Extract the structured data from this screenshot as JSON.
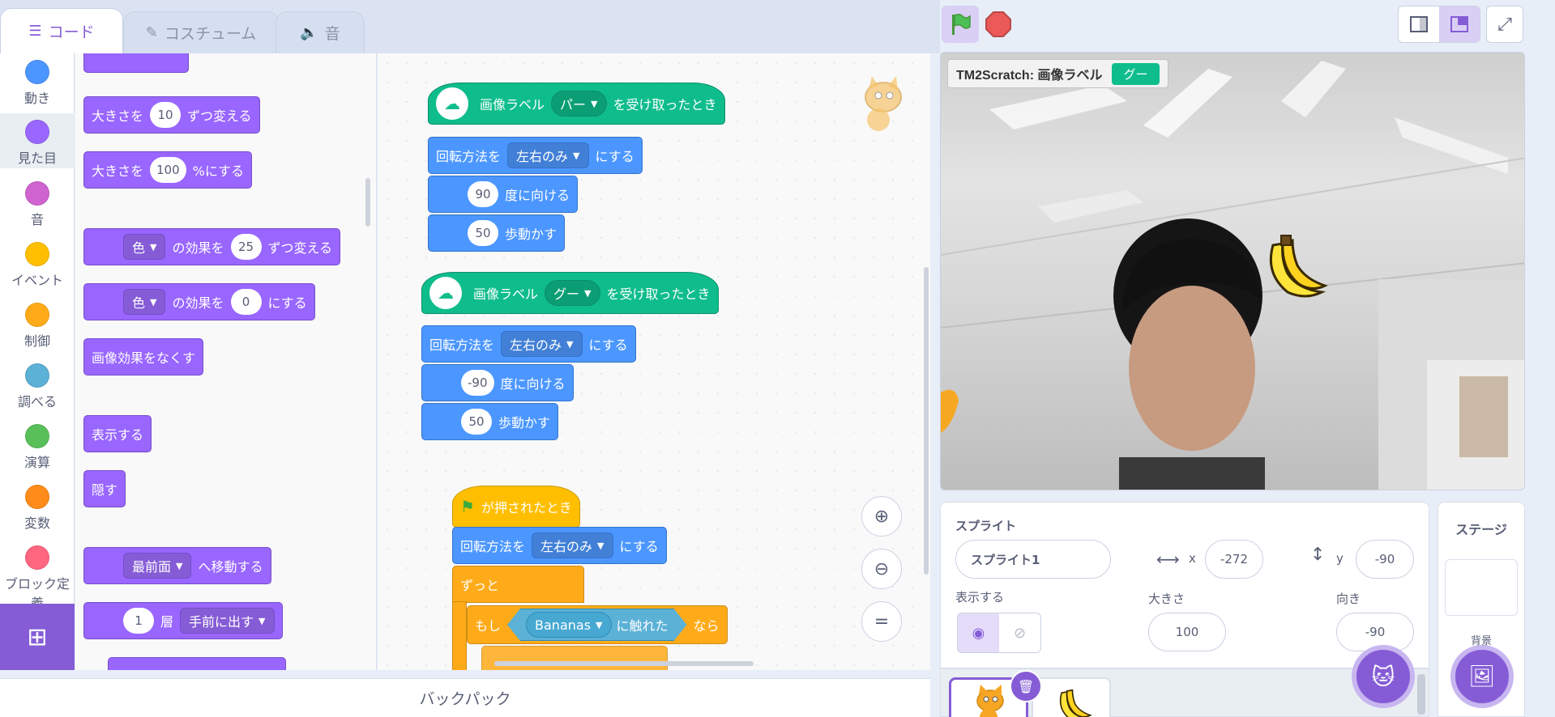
{
  "tabs": [
    {
      "label": "コード",
      "icon": "code-icon"
    },
    {
      "label": "コスチューム",
      "icon": "brush-icon"
    },
    {
      "label": "音",
      "icon": "speaker-icon"
    }
  ],
  "categories": [
    {
      "label": "動き",
      "color": "#4c97ff"
    },
    {
      "label": "見た目",
      "color": "#9966ff"
    },
    {
      "label": "音",
      "color": "#cf63cf"
    },
    {
      "label": "イベント",
      "color": "#ffbf00"
    },
    {
      "label": "制御",
      "color": "#ffab19"
    },
    {
      "label": "調べる",
      "color": "#5cb1d6"
    },
    {
      "label": "演算",
      "color": "#59c059"
    },
    {
      "label": "変数",
      "color": "#ff8c1a"
    },
    {
      "label": "ブロック定義",
      "color": "#ff6680"
    }
  ],
  "palette": {
    "size_change": {
      "pre": "大きさを",
      "val": "10",
      "post": "ずつ変える"
    },
    "size_set": {
      "pre": "大きさを",
      "val": "100",
      "post": "%にする"
    },
    "effect_change": {
      "dd": "色",
      "mid": "の効果を",
      "val": "25",
      "post": "ずつ変える"
    },
    "effect_set": {
      "dd": "色",
      "mid": "の効果を",
      "val": "0",
      "post": "にする"
    },
    "clear_effects": "画像効果をなくす",
    "show": "表示する",
    "hide": "隠す",
    "goto_layer": {
      "dd": "最前面",
      "post": "へ移動する"
    },
    "go_layers": {
      "val": "1",
      "mid": "層",
      "dd": "手前に出す"
    }
  },
  "scripts": {
    "s1": {
      "hat_pre": "画像ラベル",
      "hat_dd": "パー",
      "hat_post": "を受け取ったとき",
      "rot_pre": "回転方法を",
      "rot_dd": "左右のみ",
      "rot_post": "にする",
      "dir_val": "90",
      "dir_post": "度に向ける",
      "move_val": "50",
      "move_post": "歩動かす"
    },
    "s2": {
      "hat_pre": "画像ラベル",
      "hat_dd": "グー",
      "hat_post": "を受け取ったとき",
      "rot_pre": "回転方法を",
      "rot_dd": "左右のみ",
      "rot_post": "にする",
      "dir_val": "-90",
      "dir_post": "度に向ける",
      "move_val": "50",
      "move_post": "歩動かす"
    },
    "s3": {
      "hat": "が押されたとき",
      "rot_pre": "回転方法を",
      "rot_dd": "左右のみ",
      "rot_post": "にする",
      "forever": "ずっと",
      "if_pre": "もし",
      "if_dd": "Bananas",
      "if_mid": "に触れた",
      "if_post": "なら"
    }
  },
  "zoom": {
    "in": "zoom-in-icon",
    "out": "zoom-out-icon",
    "reset": "zoom-reset-icon"
  },
  "backpack": "バックパック",
  "stage": {
    "monitor_label": "TM2Scratch: 画像ラベル",
    "monitor_value": "グー"
  },
  "sprite": {
    "header": "スプライト",
    "name": "スプライト1",
    "x_label": "x",
    "x": "-272",
    "y_label": "y",
    "y": "-90",
    "show_label": "表示する",
    "size_label": "大きさ",
    "size": "100",
    "dir_label": "向き",
    "direction": "-90"
  },
  "stage_pane": {
    "title": "ステージ",
    "backdrops": "背景"
  },
  "colors": {
    "accent": "#855cd6",
    "looks": "#9966ff",
    "motion": "#4c97ff",
    "control": "#ffab19",
    "events": "#ffbf00",
    "extension": "#0fbd8c"
  }
}
